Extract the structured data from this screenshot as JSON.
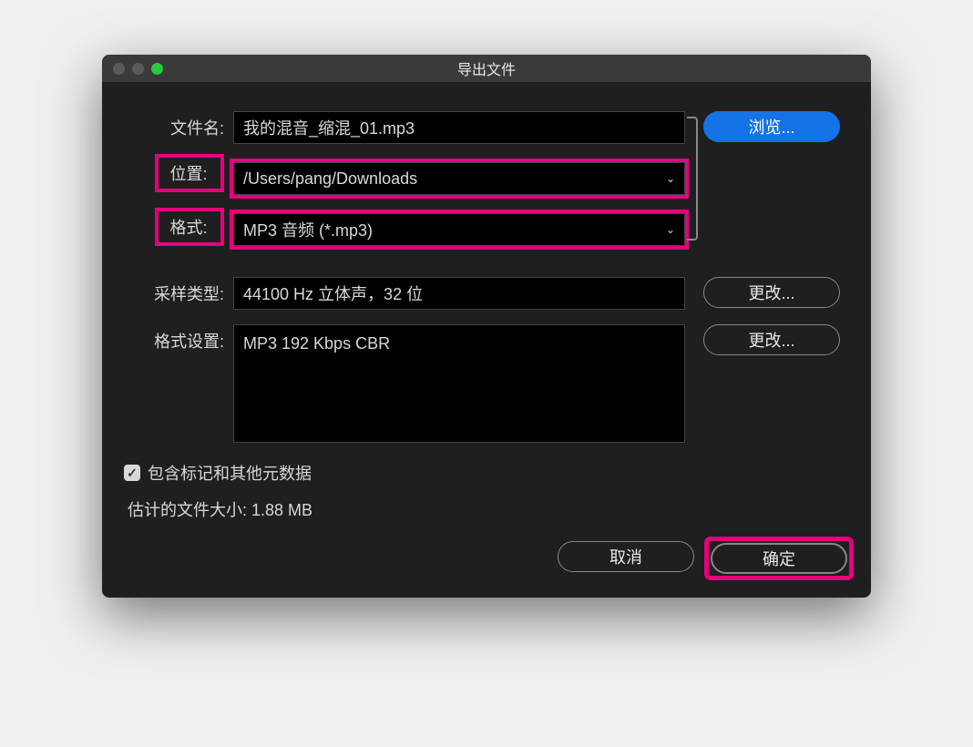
{
  "window": {
    "title": "导出文件"
  },
  "form": {
    "filename_label": "文件名:",
    "filename_value": "我的混音_缩混_01.mp3",
    "location_label": "位置:",
    "location_value": "/Users/pang/Downloads",
    "format_label": "格式:",
    "format_value": "MP3 音频 (*.mp3)",
    "browse_button": "浏览...",
    "sampletype_label": "采样类型:",
    "sampletype_value": "44100 Hz 立体声，32 位",
    "change_button": "更改...",
    "formatsettings_label": "格式设置:",
    "formatsettings_value": "MP3 192 Kbps CBR"
  },
  "checkbox": {
    "include_metadata_label": "包含标记和其他元数据"
  },
  "estimate": {
    "label": "估计的文件大小: ",
    "value": "1.88 MB"
  },
  "footer": {
    "cancel": "取消",
    "ok": "确定"
  }
}
